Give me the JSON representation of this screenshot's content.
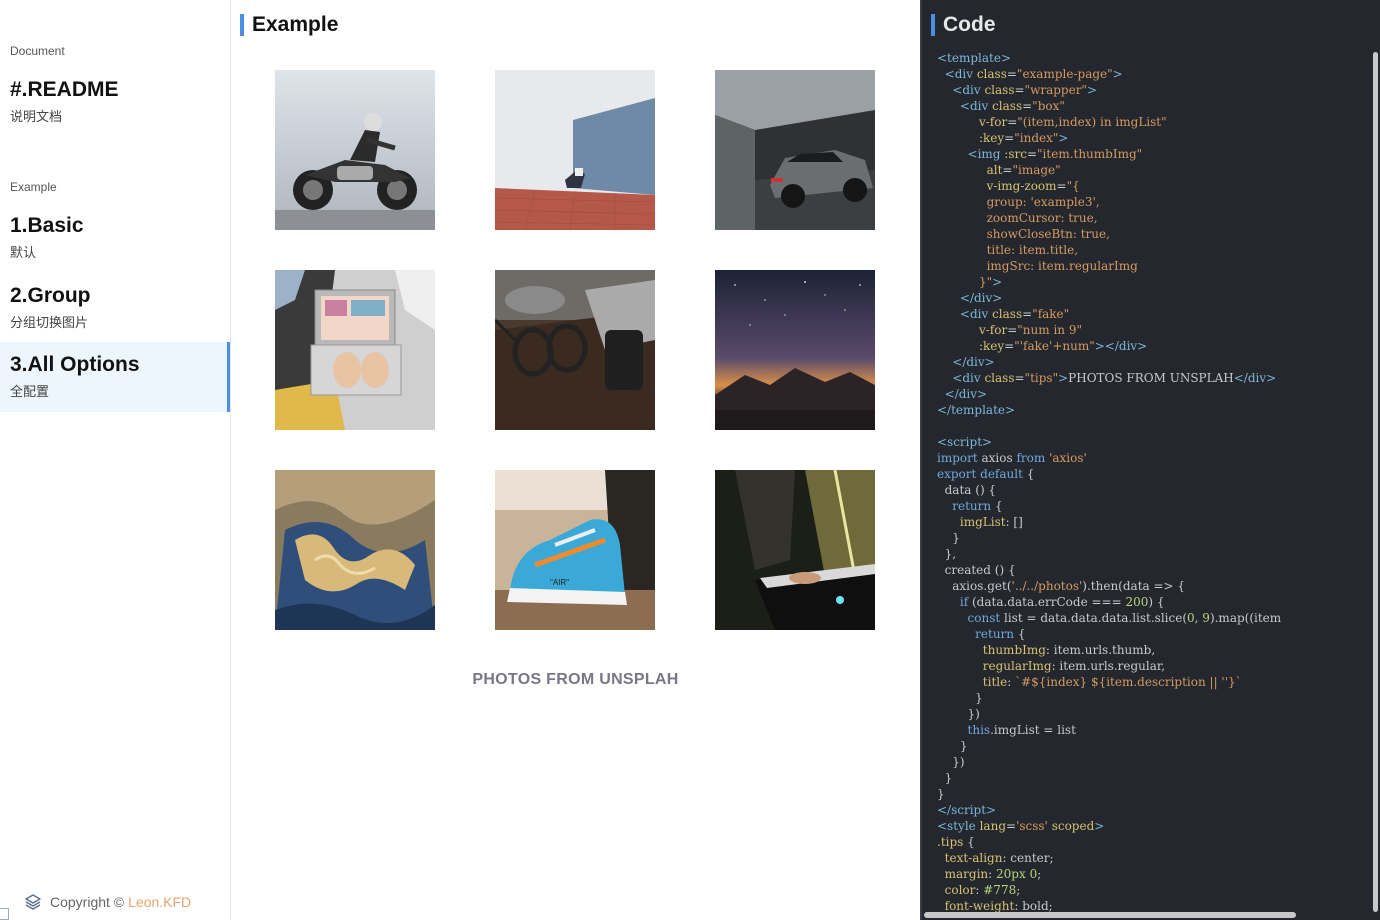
{
  "sidebar": {
    "document_group": "Document",
    "example_group": "Example",
    "items": [
      {
        "title": "#.README",
        "subtitle": "说明文档"
      },
      {
        "title": "1.Basic",
        "subtitle": "默认"
      },
      {
        "title": "2.Group",
        "subtitle": "分组切换图片"
      },
      {
        "title": "3.All Options",
        "subtitle": "全配置"
      }
    ],
    "active_item": "3.All Options",
    "copyright_prefix": "Copyright ©",
    "copyright_author": "Leon.KFD"
  },
  "example": {
    "title": "Example",
    "photos": [
      {
        "subject": "motorcycle"
      },
      {
        "subject": "person-leaning-on-wall"
      },
      {
        "subject": "suv-car"
      },
      {
        "subject": "laptop-typing"
      },
      {
        "subject": "glasses-on-desk"
      },
      {
        "subject": "starry-sky-mountains"
      },
      {
        "subject": "aerial-terrain"
      },
      {
        "subject": "sneaker"
      },
      {
        "subject": "piano-player"
      }
    ],
    "tips": "PHOTOS FROM UNSPLAH"
  },
  "code": {
    "title": "Code"
  },
  "colors": {
    "accent": "#4a90e2",
    "active_bg": "#eef6fd",
    "code_bg": "#24272e",
    "tips": "#778",
    "author": "#e5a46a"
  }
}
